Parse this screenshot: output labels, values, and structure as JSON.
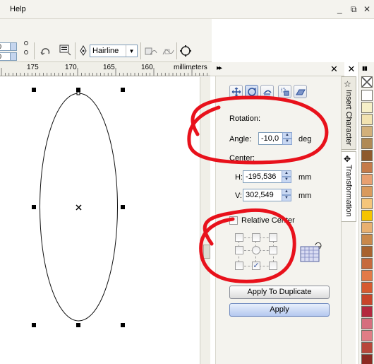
{
  "menubar": {
    "help_label": "Help",
    "minimize": "_",
    "restore": "⧉",
    "close": "✕"
  },
  "toolbar": {
    "outline_width": "Hairline",
    "spin_values": [
      "0",
      "0"
    ]
  },
  "ruler": {
    "labels": [
      "175",
      "170",
      "165",
      "160"
    ],
    "units": "millimeters"
  },
  "docker": {
    "header_arrows": "▸▸",
    "close": "✕",
    "tabs": [
      "Insert Character",
      "Transformation"
    ],
    "transform_buttons": [
      "position-icon",
      "rotate-icon",
      "scale-icon",
      "size-icon",
      "skew-icon"
    ],
    "rotation_title": "Rotation:",
    "angle_label": "Angle:",
    "angle_value": "-10,0",
    "angle_unit": "deg",
    "center_label": "Center:",
    "h_label": "H:",
    "h_value": "-195,536",
    "h_unit": "mm",
    "v_label": "V:",
    "v_value": "302,549",
    "v_unit": "mm",
    "relative_center_label": "Relative Center",
    "relative_center_checked": false,
    "apply_duplicate_label": "Apply To Duplicate",
    "apply_label": "Apply"
  },
  "palette": {
    "colors": [
      "#ffffff",
      "#f6f0c8",
      "#f2e3b0",
      "#d2b07a",
      "#b08a55",
      "#8e5a2c",
      "#c57b4a",
      "#e8a070",
      "#d99a5c",
      "#f4c57a",
      "#f5c400",
      "#e8b070",
      "#c9884a",
      "#a8622e",
      "#c66a3d",
      "#e27a48",
      "#d65a30",
      "#c8442a",
      "#b3283e",
      "#d66e7e",
      "#e07d85",
      "#b8473a",
      "#8c2a22",
      "#d2484c"
    ]
  },
  "colors": {
    "annotation": "#e8111b",
    "selection": "#000000"
  }
}
